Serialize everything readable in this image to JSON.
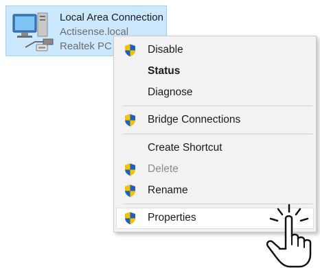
{
  "connection": {
    "name": "Local Area Connection",
    "domain": "Actisense.local",
    "adapter": "Realtek PC",
    "icon": "network-adapter-icon"
  },
  "menu": {
    "disable": "Disable",
    "status": "Status",
    "diagnose": "Diagnose",
    "bridge": "Bridge Connections",
    "create_shortcut": "Create Shortcut",
    "delete": "Delete",
    "rename": "Rename",
    "properties": "Properties"
  },
  "colors": {
    "selection_bg": "#cce8ff",
    "menu_bg": "#f2f2f2",
    "shield_blue": "#1f5fbf",
    "shield_gold": "#f5c400"
  }
}
